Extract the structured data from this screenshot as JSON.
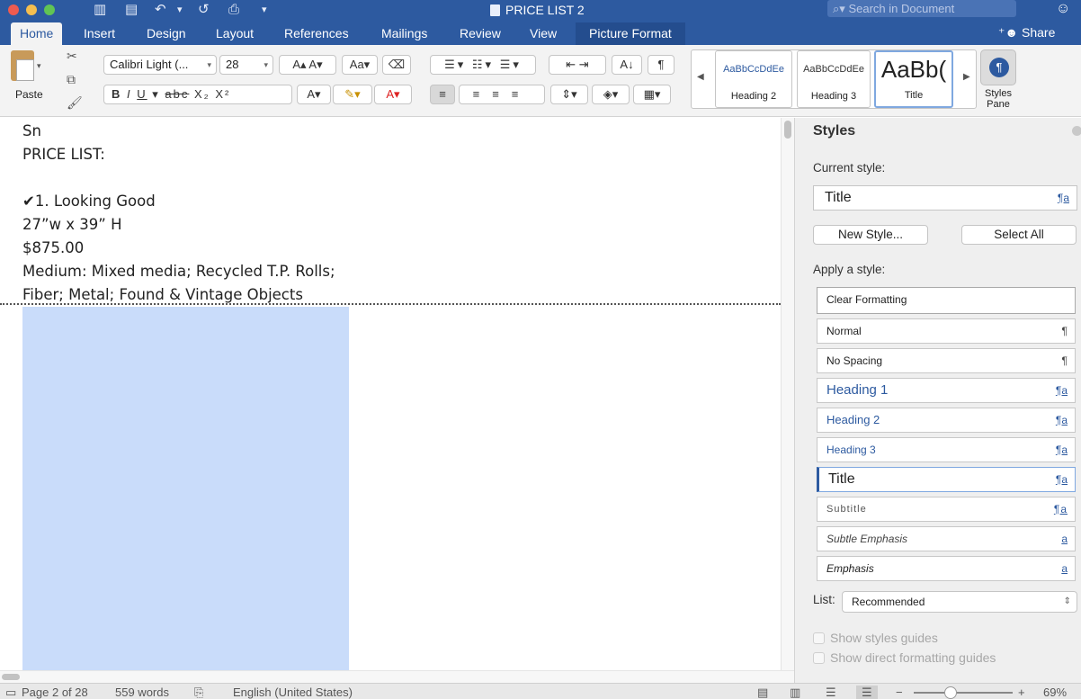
{
  "window": {
    "title": "PRICE LIST 2",
    "search_placeholder": "Search in Document"
  },
  "tabs": [
    "Home",
    "Insert",
    "Design",
    "Layout",
    "References",
    "Mailings",
    "Review",
    "View",
    "Picture Format"
  ],
  "share_label": "Share",
  "ribbon": {
    "paste_label": "Paste",
    "font_name": "Calibri Light (...",
    "font_size": "28",
    "styles_gallery": [
      {
        "sample": "AaBbCcDdEe",
        "name": "Heading 2"
      },
      {
        "sample": "AaBbCcDdEe",
        "name": "Heading 3"
      },
      {
        "sample": "AaBb(",
        "name": "Title"
      }
    ],
    "styles_pane_label": "Styles Pane"
  },
  "document": {
    "lines": [
      "Sn",
      "PRICE LIST:",
      "",
      "✔1. Looking Good",
      "27”w x 39” H",
      "$875.00",
      "Medium: Mixed media; Recycled T.P. Rolls;",
      "Fiber; Metal; Found & Vintage Objects"
    ]
  },
  "styles_pane": {
    "title": "Styles",
    "current_style_label": "Current style:",
    "current_style": "Title",
    "new_style_label": "New Style...",
    "select_all_label": "Select All",
    "apply_label": "Apply a style:",
    "styles": [
      {
        "name": "Clear Formatting",
        "marker": ""
      },
      {
        "name": "Normal",
        "marker": "¶"
      },
      {
        "name": "No Spacing",
        "marker": "¶"
      },
      {
        "name": "Heading 1",
        "marker": "¶a"
      },
      {
        "name": "Heading 2",
        "marker": "¶a"
      },
      {
        "name": "Heading 3",
        "marker": "¶a"
      },
      {
        "name": "Title",
        "marker": "¶a"
      },
      {
        "name": "Subtitle",
        "marker": "¶a"
      },
      {
        "name": "Subtle Emphasis",
        "marker": "a"
      },
      {
        "name": "Emphasis",
        "marker": "a"
      }
    ],
    "list_label": "List:",
    "list_value": "Recommended",
    "show_guides": "Show styles guides",
    "show_direct": "Show direct formatting guides"
  },
  "status": {
    "page": "Page 2 of 28",
    "words": "559 words",
    "language": "English (United States)",
    "zoom": "69%"
  }
}
